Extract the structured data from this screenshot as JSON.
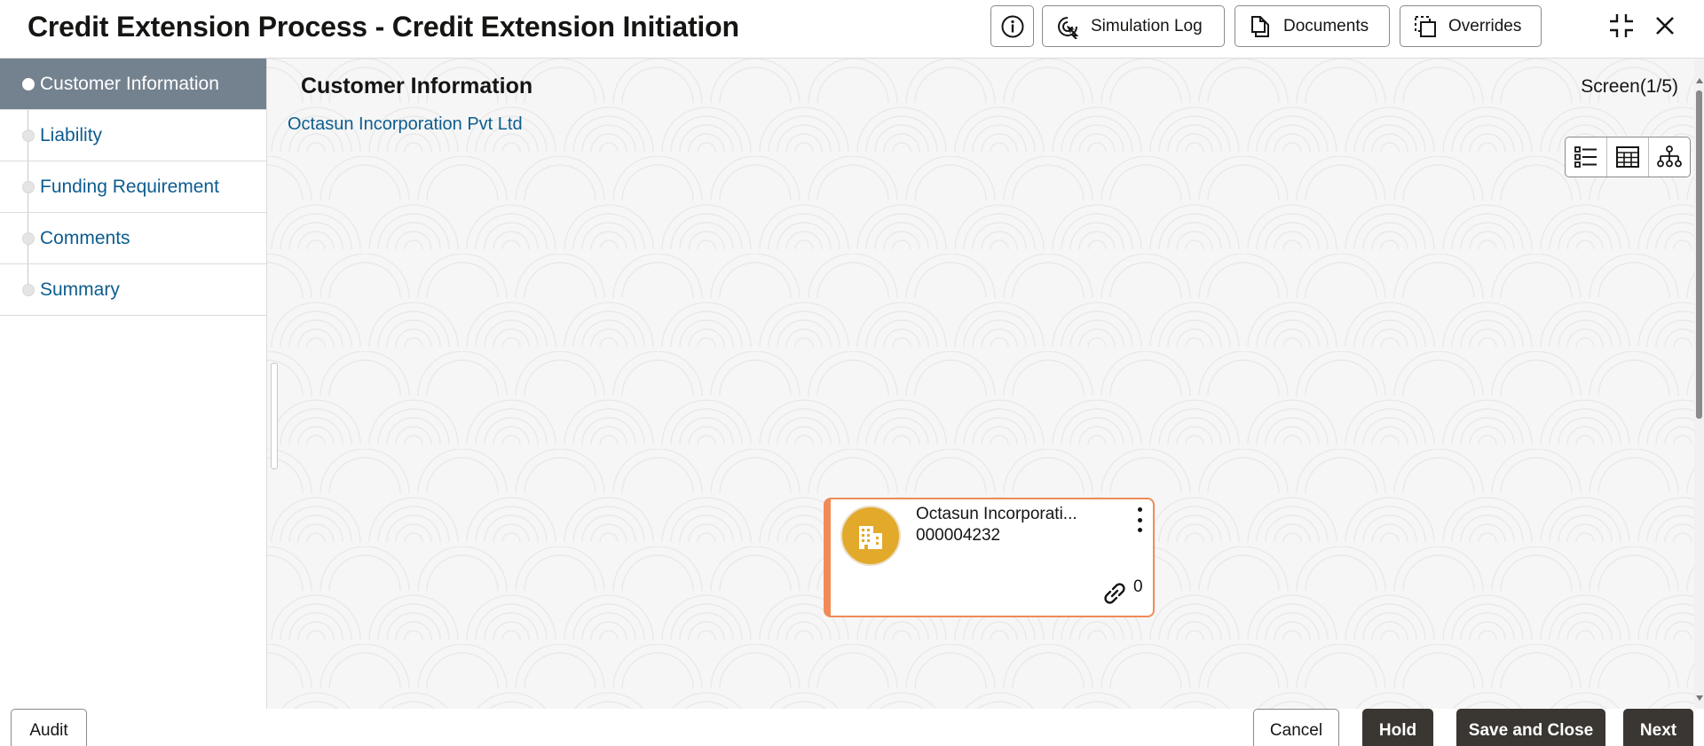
{
  "header": {
    "title": "Credit Extension Process - Credit Extension Initiation",
    "buttons": {
      "simulation_log": "Simulation Log",
      "documents": "Documents",
      "overrides": "Overrides"
    },
    "icons": [
      "info-icon",
      "simulation-log-icon",
      "documents-icon",
      "overrides-icon",
      "minimize-icon",
      "close-icon"
    ]
  },
  "nav": {
    "items": [
      {
        "label": "Customer Information",
        "active": true
      },
      {
        "label": "Liability",
        "active": false
      },
      {
        "label": "Funding Requirement",
        "active": false
      },
      {
        "label": "Comments",
        "active": false
      },
      {
        "label": "Summary",
        "active": false
      }
    ]
  },
  "main": {
    "section_title": "Customer Information",
    "screen_counter": "Screen(1/5)",
    "customer_link": "Octasun Incorporation Pvt Ltd",
    "view_toggle": [
      "list-view-icon",
      "table-view-icon",
      "hierarchy-view-icon"
    ],
    "card": {
      "name": "Octasun Incorporati...",
      "id": "000004232",
      "link_count": "0",
      "avatar_icon": "building-icon"
    }
  },
  "footer": {
    "audit": "Audit",
    "cancel": "Cancel",
    "hold": "Hold",
    "save_and_close": "Save and Close",
    "next": "Next"
  },
  "colors": {
    "active_nav_bg": "#74828f",
    "link_text": "#0d5d8f",
    "card_accent": "#f08b57",
    "avatar_bg": "#e3a92a",
    "dark_button": "#3a3632"
  }
}
